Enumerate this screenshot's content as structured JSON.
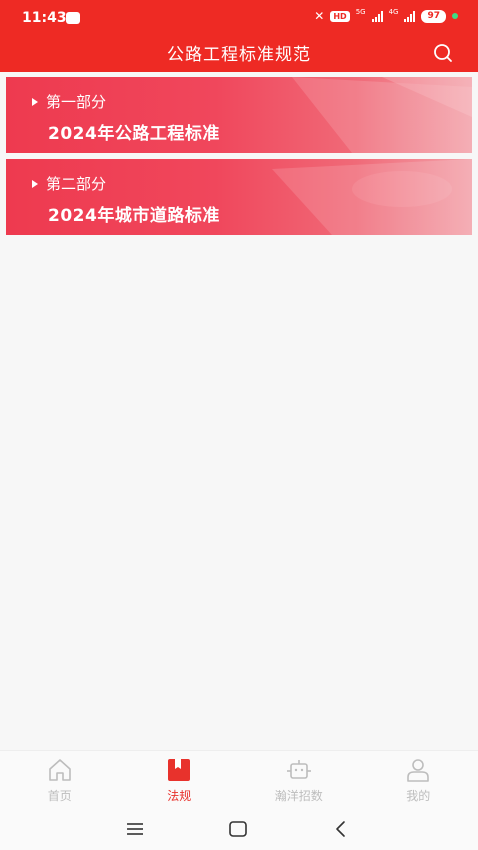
{
  "status_bar": {
    "time": "11:43",
    "hd": "HD",
    "net1": "5G",
    "net2": "4G",
    "battery": "97"
  },
  "header": {
    "title": "公路工程标准规范",
    "search_icon": "search-icon"
  },
  "cards": [
    {
      "part": "第一部分",
      "title": "2024年公路工程标准"
    },
    {
      "part": "第二部分",
      "title": "2024年城市道路标准"
    }
  ],
  "tabbar": {
    "tabs": [
      {
        "label": "首页",
        "icon": "home-icon",
        "active": false
      },
      {
        "label": "法规",
        "icon": "book-icon",
        "active": true
      },
      {
        "label": "瀚洋招数",
        "icon": "robot-icon",
        "active": false
      },
      {
        "label": "我的",
        "icon": "user-icon",
        "active": false
      }
    ]
  },
  "colors": {
    "primary": "#ee2a24",
    "active_tab": "#e8322c",
    "inactive_tab": "#bdbdbd",
    "background": "#f7f7f7"
  }
}
